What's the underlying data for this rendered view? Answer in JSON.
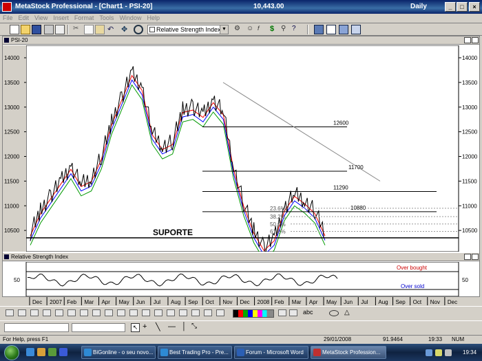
{
  "window": {
    "title": "MetaStock Professional - [Chart1 - PSI-20]",
    "last_value": "10,443.00",
    "periodicity": "Daily",
    "controls": [
      "_",
      "□",
      "×"
    ]
  },
  "menu": [
    "File",
    "Edit",
    "View",
    "Insert",
    "Format",
    "Tools",
    "Window",
    "Help"
  ],
  "toolbar": {
    "indicator": "Relative Strength Index",
    "icons": [
      "new-icon",
      "open-icon",
      "save-icon",
      "print-icon",
      "print-preview-icon",
      "cut-icon",
      "copy-icon",
      "paste-icon",
      "undo-icon",
      "move-icon",
      "zoom-icon",
      "refresh-icon",
      "indicator-builder-icon",
      "expert-icon",
      "formula-icon",
      "dollar-icon",
      "explorer-icon",
      "help-pointer-icon",
      "layout-icon-1",
      "layout-icon-2",
      "layout-icon-3",
      "layout-icon-4"
    ]
  },
  "price_panel": {
    "title": "PSI-20",
    "label_suporte": "SUPORTE",
    "levels": [
      "12600",
      "11700",
      "11290",
      "10880"
    ],
    "fibonacci": [
      "23.6%",
      "38.2%",
      "50.0%",
      "61.8%",
      "100.0%"
    ],
    "y_ticks": [
      "14000",
      "13500",
      "13000",
      "12500",
      "12000",
      "11500",
      "11000",
      "10500",
      "10000"
    ]
  },
  "rsi_panel": {
    "title": "Relative Strength Index",
    "y_ticks": [
      "50"
    ],
    "label_overbought": "Over bought",
    "label_oversold": "Over sold"
  },
  "x_axis": [
    "Dec",
    "2007",
    "Feb",
    "Mar",
    "Apr",
    "May",
    "Jun",
    "Jul",
    "Aug",
    "Sep",
    "Oct",
    "Nov",
    "Dec",
    "2008",
    "Feb",
    "Mar",
    "Apr",
    "May",
    "Jun",
    "Jul",
    "Aug",
    "Sep",
    "Oct",
    "Nov",
    "Dec"
  ],
  "chart_data": {
    "type": "line",
    "title": "PSI-20",
    "series": [
      {
        "values": [
          10450,
          10900,
          11200,
          11500,
          11800,
          11450,
          11550,
          12000,
          12700,
          13200,
          13700,
          13400,
          12500,
          12200,
          12300,
          12950,
          13000,
          12850,
          13150,
          12900,
          11800,
          11050,
          10500,
          10150,
          10350,
          10950,
          11250,
          11100,
          10900,
          10450
        ]
      }
    ],
    "x": [
      "Dec 2006",
      "Jan 2007",
      "Feb",
      "Mar",
      "Apr",
      "May",
      "Jun",
      "Jul",
      "Aug",
      "Sep",
      "Oct",
      "Nov",
      "Dec",
      "Jan 2008",
      "Feb",
      "Mar",
      "Apr",
      "May",
      "Jun"
    ],
    "ylim": [
      10000,
      14000
    ],
    "horizontal_levels": [
      12600,
      11700,
      11290,
      10880
    ],
    "support": 10350,
    "colors": {
      "price": "#000000",
      "ma_fast": "#ff0000",
      "ma_mid": "#0000ff",
      "ma_slow": "#009900",
      "rsi_overbought": "#cc0000",
      "rsi_oversold": "#0000cc"
    }
  },
  "draw_toolbar": {
    "icons": [
      "pointer-icon",
      "crosshair-icon",
      "line-icon",
      "horizontal-line-icon",
      "vertical-line-icon",
      "trendline-icon",
      "text-icon",
      "ellipse-icon",
      "triangle-icon"
    ]
  },
  "statusbar": {
    "help": "For Help, press F1",
    "date": "29/01/2008",
    "value": "91.9464",
    "time": "19:33",
    "num": "NUM"
  },
  "taskbar": {
    "items": [
      "BiGonline - o seu novo...",
      "Best Trading Pro - Pre...",
      "Forum - Microsoft Word",
      "MetaStock Profession..."
    ],
    "clock": "19:34"
  }
}
